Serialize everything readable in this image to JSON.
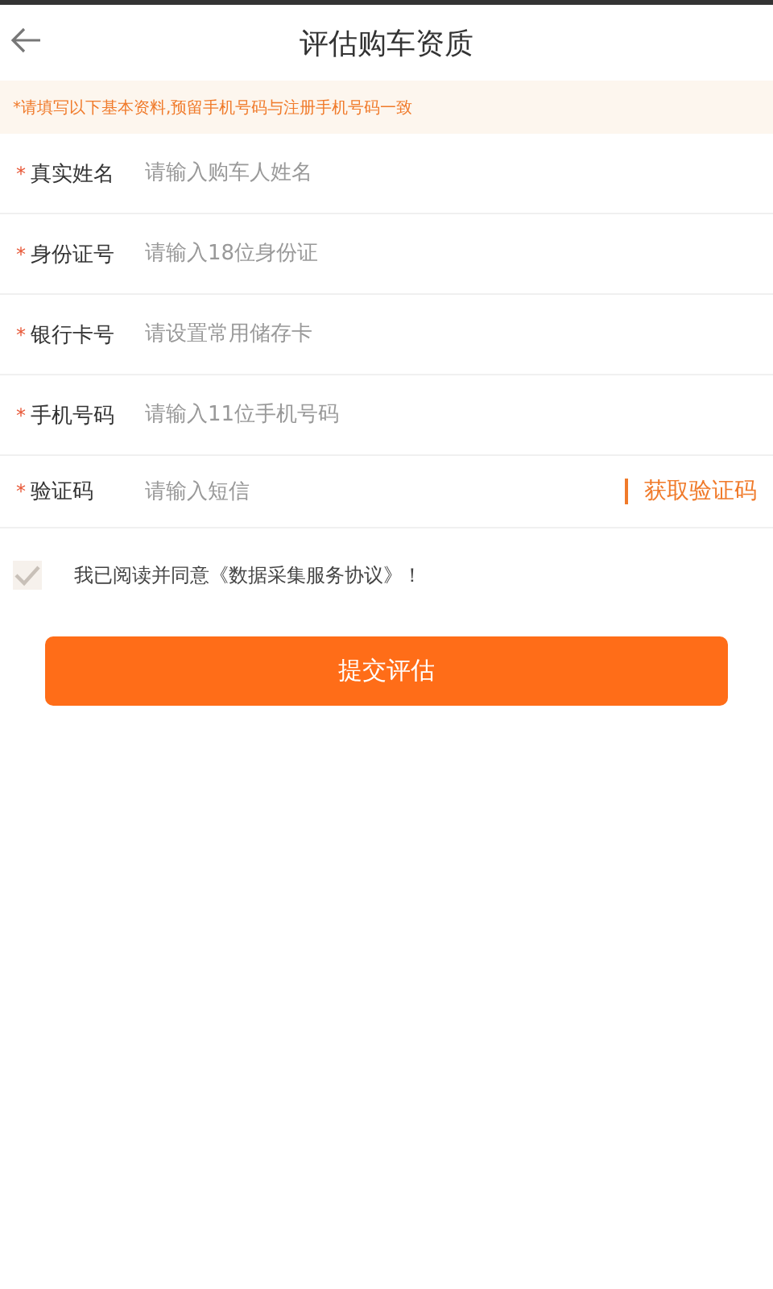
{
  "header": {
    "title": "评估购车资质"
  },
  "notice": "*请填写以下基本资料,预留手机号码与注册手机号码一致",
  "fields": [
    {
      "marker": "*",
      "label": "真实姓名",
      "placeholder": "请输入购车人姓名"
    },
    {
      "marker": "*",
      "label": "身份证号",
      "placeholder": "请输入18位身份证"
    },
    {
      "marker": "*",
      "label": "银行卡号",
      "placeholder": "请设置常用储存卡"
    },
    {
      "marker": "*",
      "label": "手机号码",
      "placeholder": "请输入11位手机号码"
    },
    {
      "marker": "*",
      "label": "验证码",
      "placeholder": "请输入短信",
      "action": "获取验证码"
    }
  ],
  "agreement": {
    "checked": true,
    "text": "我已阅读并同意《数据采集服务协议》！"
  },
  "submit": "提交评估"
}
